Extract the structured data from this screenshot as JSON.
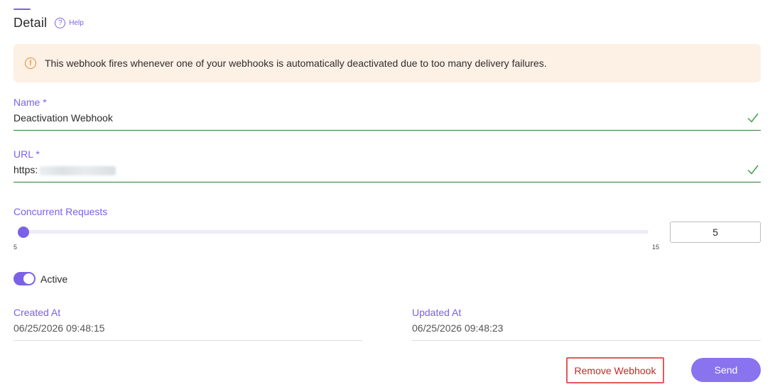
{
  "header": {
    "title": "Detail",
    "help_icon": "?",
    "help_label": "Help"
  },
  "alert": {
    "icon": "!",
    "message": "This webhook fires whenever one of your webhooks is automatically deactivated due to too many delivery failures."
  },
  "form": {
    "name": {
      "label": "Name *",
      "value": "Deactivation Webhook",
      "valid": true
    },
    "url": {
      "label": "URL *",
      "value_prefix": "https:",
      "valid": true
    },
    "concurrent_requests": {
      "label": "Concurrent Requests",
      "min": "5",
      "max": "15",
      "value": "5"
    },
    "active": {
      "label": "Active",
      "enabled": true
    }
  },
  "meta": {
    "created_label": "Created At",
    "created_value": "06/25/2026 09:48:15",
    "updated_label": "Updated At",
    "updated_value": "06/25/2026 09:48:23"
  },
  "actions": {
    "remove_label": "Remove Webhook",
    "send_label": "Send"
  },
  "colors": {
    "accent": "#7b61e8",
    "alert_bg": "#fdf0e5",
    "alert_icon": "#e8892b",
    "valid": "#2e7d32",
    "danger": "#c62828"
  }
}
